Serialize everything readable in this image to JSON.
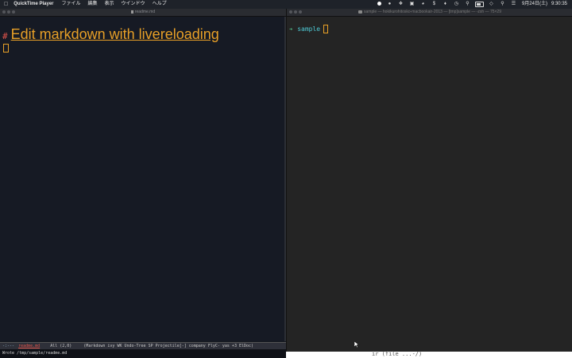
{
  "menubar": {
    "apple_icon": "apple-icon",
    "app_name": "QuickTime Player",
    "menus": [
      "ファイル",
      "編集",
      "表示",
      "ウインドウ",
      "ヘルプ"
    ],
    "status_icons": [
      "record-icon",
      "circle-icon",
      "dropbox-icon",
      "box-icon",
      "headphones-icon",
      "dollar-icon",
      "evernote-icon",
      "history-icon",
      "spotlight-icon",
      "battery-icon",
      "wifi-icon",
      "search-icon",
      "list-icon"
    ],
    "date": "9月24日(土)",
    "time": "9:30:35"
  },
  "emacs": {
    "title": "readme.md",
    "heading_marker": "#",
    "heading_text": "Edit markdown with livereloading",
    "modeline": {
      "status": "-:---",
      "buffer": "readme.md",
      "position": "All (2,0)",
      "modes": "(Markdown ivy WK Undo-Tree SP Projectile[-] company FlyC- yas +3 ElDoc)"
    },
    "minibuffer": "Wrote /tmp/sample/readme.md"
  },
  "terminal": {
    "title": "sample — hokikurohitosko-macbookair-2013 — [tmp]sample — -zsh — 75×29",
    "prompt_dir": "sample"
  },
  "bottom_fragment": "ir (file ...-/)"
}
